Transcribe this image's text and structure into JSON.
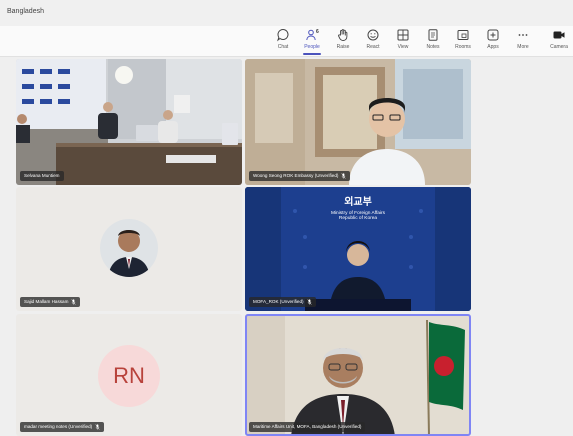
{
  "window": {
    "title": "Bangladesh"
  },
  "toolbar": {
    "buttons": [
      {
        "id": "chat",
        "label": "Chat",
        "icon": "chat-icon"
      },
      {
        "id": "people",
        "label": "People",
        "icon": "people-icon",
        "count": "6",
        "active": true
      },
      {
        "id": "raise",
        "label": "Raise",
        "icon": "hand-icon"
      },
      {
        "id": "react",
        "label": "React",
        "icon": "smile-icon"
      },
      {
        "id": "view",
        "label": "View",
        "icon": "grid-icon"
      },
      {
        "id": "notes",
        "label": "Notes",
        "icon": "notes-icon"
      },
      {
        "id": "rooms",
        "label": "Rooms",
        "icon": "rooms-icon"
      },
      {
        "id": "apps",
        "label": "Apps",
        "icon": "apps-icon"
      },
      {
        "id": "more",
        "label": "More",
        "icon": "more-icon"
      },
      {
        "id": "camera",
        "label": "Camera",
        "icon": "camera-icon"
      }
    ]
  },
  "participants": [
    {
      "name": "Selvana Muntiem",
      "muted": false
    },
    {
      "name": "Woong Seong ROK Embassy (Unverified)",
      "muted": true
    },
    {
      "name": "Sajid Mallam Hassam",
      "muted": true
    },
    {
      "name": "MOFA_ROK (Unverified)",
      "muted": true
    },
    {
      "name": "madar meeting notes (Unverified)",
      "muted": true,
      "initials": "RN"
    },
    {
      "name": "Maritime Affairs Unit, MOFA, Bangladesh (Unverified)",
      "muted": false,
      "speaking": true
    }
  ],
  "mofa_backdrop": {
    "korean": "외교부",
    "line1": "Ministry of Foreign Affairs",
    "line2": "Republic of Korea"
  },
  "colors": {
    "accent": "#4b53bc",
    "speaking_outline": "#7f85f5",
    "initials_bg": "#f7d9d9",
    "initials_fg": "#b8423b"
  }
}
